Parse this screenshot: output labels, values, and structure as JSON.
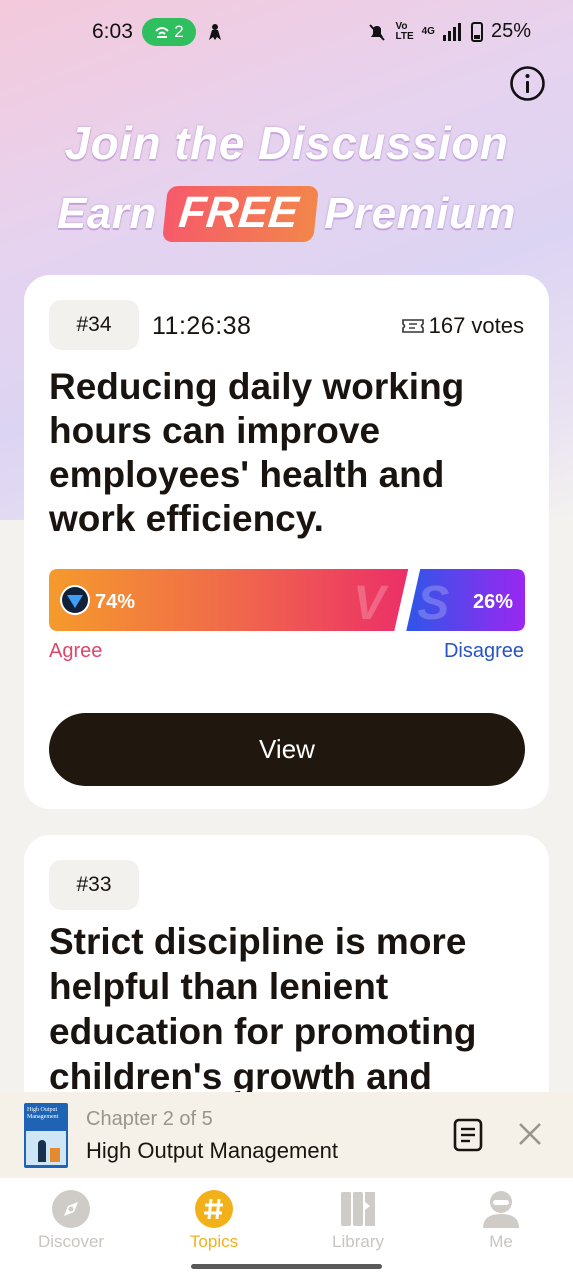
{
  "status_bar": {
    "time": "6:03",
    "notif_count": "2",
    "net_vo": "Vo",
    "net_lte": "LTE",
    "net_type": "4G",
    "battery": "25%"
  },
  "hero": {
    "line1": "Join the Discussion",
    "line2_before": "Earn",
    "line2_badge": "FREE",
    "line2_after": "Premium"
  },
  "topics": [
    {
      "number": "#34",
      "timer": "11:26:38",
      "votes": "167 votes",
      "statement": "Reducing daily working hours can improve employees' health and work efficiency.",
      "agree_percent": "74%",
      "disagree_percent": "26%",
      "agree_share": 0.74,
      "agree_label": "Agree",
      "disagree_label": "Disagree",
      "vs_mark": "VS",
      "view_label": "View"
    },
    {
      "number": "#33",
      "statement": "Strict discipline is more helpful than lenient education for promoting children's growth and"
    }
  ],
  "now_reading": {
    "cover_title": "High Output Management",
    "chapter": "Chapter 2 of 5",
    "title": "High Output Management"
  },
  "nav": {
    "items": [
      {
        "label": "Discover",
        "icon": "compass-icon"
      },
      {
        "label": "Topics",
        "icon": "hashtag-icon",
        "active": true
      },
      {
        "label": "Library",
        "icon": "books-icon"
      },
      {
        "label": "Me",
        "icon": "user-icon"
      }
    ]
  },
  "colors": {
    "accent": "#f2b11b",
    "agree": "#e0456b",
    "disagree": "#2a52c4",
    "button": "#20180f"
  }
}
